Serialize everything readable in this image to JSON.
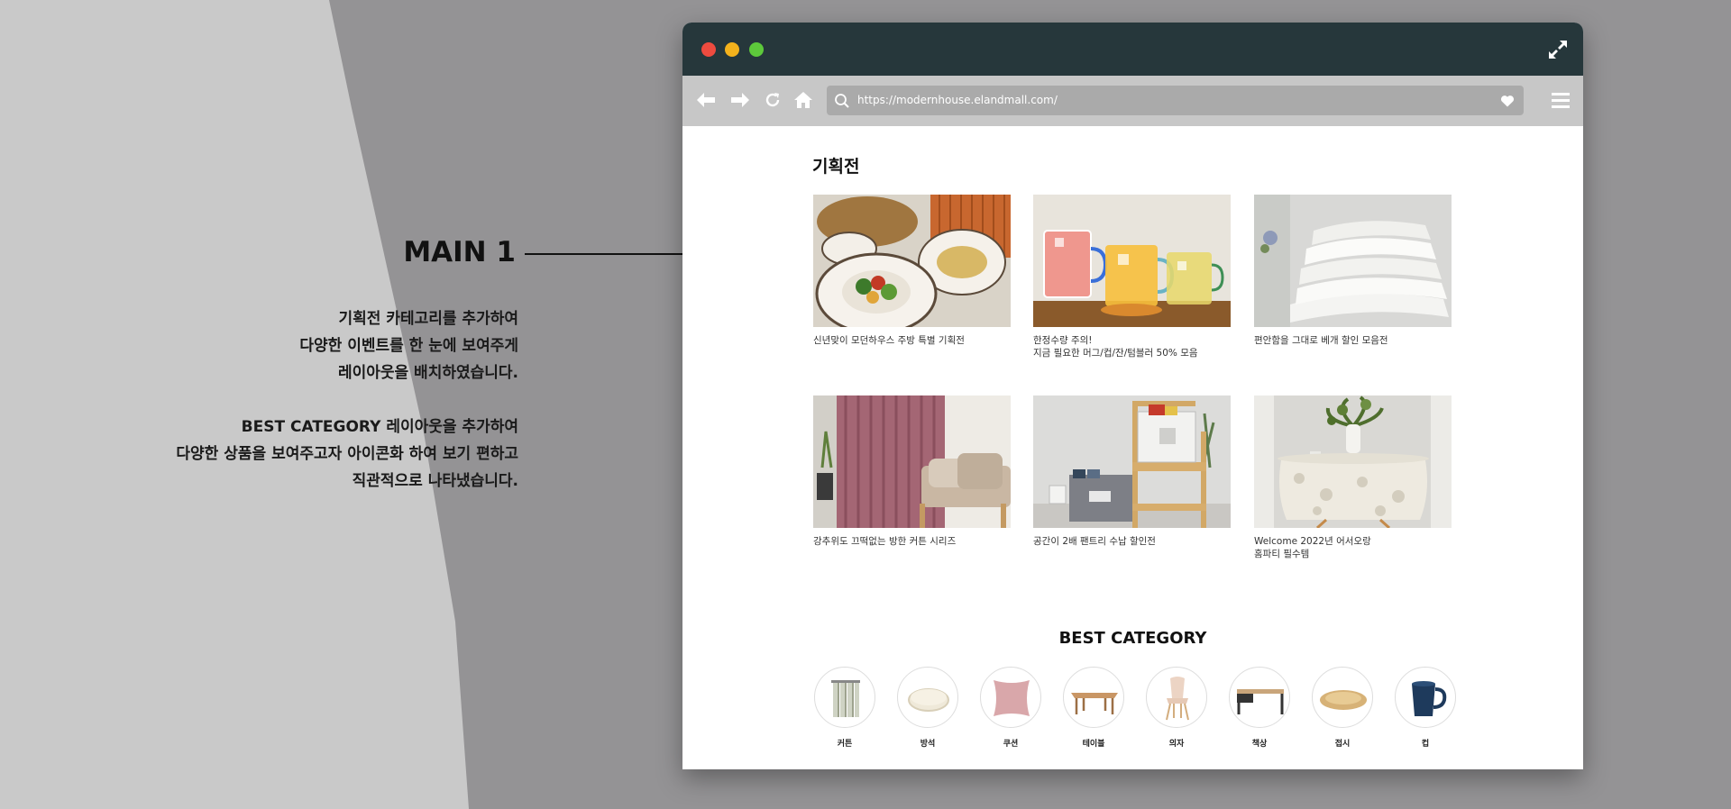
{
  "annotation": {
    "title": "MAIN 1",
    "paragraph1": [
      "기획전 카테고리를 추가하여",
      "다양한 이벤트를 한 눈에 보여주게",
      "레이아웃을 배치하였습니다."
    ],
    "paragraph2": [
      "BEST CATEGORY 레이아웃을 추가하여",
      "다양한 상품을 보여주고자 아이콘화 하여 보기 편하고",
      "직관적으로 나타냈습니다."
    ]
  },
  "browser": {
    "url": "https://modernhouse.elandmall.com/",
    "colors": {
      "titlebar": "#26373b",
      "toolbar": "#c7c7c7",
      "close": "#ee4b3f",
      "minimize": "#f4b21c",
      "maximize": "#5dc93b"
    }
  },
  "page": {
    "section_title": "기획전",
    "cards": [
      {
        "caption": [
          "신년맞이 모던하우스 주방 특별 기획전"
        ]
      },
      {
        "caption": [
          "한정수량 주의!",
          "지금 필요한 머그/컵/잔/텀블러 50% 모음"
        ]
      },
      {
        "caption": [
          "편안함을 그대로 베개 할인 모음전"
        ]
      },
      {
        "caption": [
          "강추위도 끄떡없는 방한 커튼 시리즈"
        ]
      },
      {
        "caption": [
          "공간이 2배 팬트리 수납 할인전"
        ]
      },
      {
        "caption": [
          "Welcome 2022년 어서오랑",
          "홈파티 필수템"
        ]
      }
    ],
    "best_title": "BEST CATEGORY",
    "categories": [
      {
        "label": "커튼",
        "icon": "curtain-icon"
      },
      {
        "label": "방석",
        "icon": "cushion-pad-icon"
      },
      {
        "label": "쿠션",
        "icon": "pillow-icon"
      },
      {
        "label": "테이블",
        "icon": "table-icon"
      },
      {
        "label": "의자",
        "icon": "chair-icon"
      },
      {
        "label": "책상",
        "icon": "desk-icon"
      },
      {
        "label": "접시",
        "icon": "plate-icon"
      },
      {
        "label": "컵",
        "icon": "mug-icon"
      }
    ]
  }
}
